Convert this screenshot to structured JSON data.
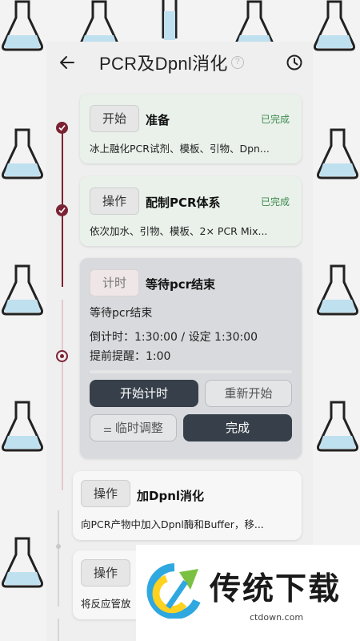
{
  "header": {
    "title": "PCR及Dpnl消化",
    "help_icon": "?",
    "back_icon": "back-arrow-icon",
    "history_icon": "clock-icon"
  },
  "steps": [
    {
      "tag": "开始",
      "name": "准备",
      "status": "已完成",
      "desc": "冰上融化PCR试剂、模板、引物、Dpn..."
    },
    {
      "tag": "操作",
      "name": "配制PCR体系",
      "status": "已完成",
      "desc": "依次加水、引物、模板、2× PCR Mix..."
    },
    {
      "tag": "计时",
      "name": "等待pcr结束",
      "detail": "等待pcr结束",
      "countdown": "倒计时：1:30:00 / 设定 1:30:00",
      "reminder": "提前提醒：1:00",
      "buttons": {
        "start_timer": "开始计时",
        "restart": "重新开始",
        "adjust": "临时调整",
        "complete": "完成"
      }
    },
    {
      "tag": "操作",
      "name": "加Dpnl消化",
      "desc": "向PCR产物中加入Dpnl酶和Buffer，移..."
    },
    {
      "tag": "操作",
      "name": "",
      "desc": "将反应管放"
    }
  ],
  "watermark": {
    "text": "传统下载",
    "url": "ctdown.com"
  },
  "colors": {
    "accent": "#7b2234",
    "done_bg": "#e9f1ea",
    "done_text": "#3f8a4f",
    "active_bg": "#d8dadd",
    "dark_button": "#37404a"
  }
}
